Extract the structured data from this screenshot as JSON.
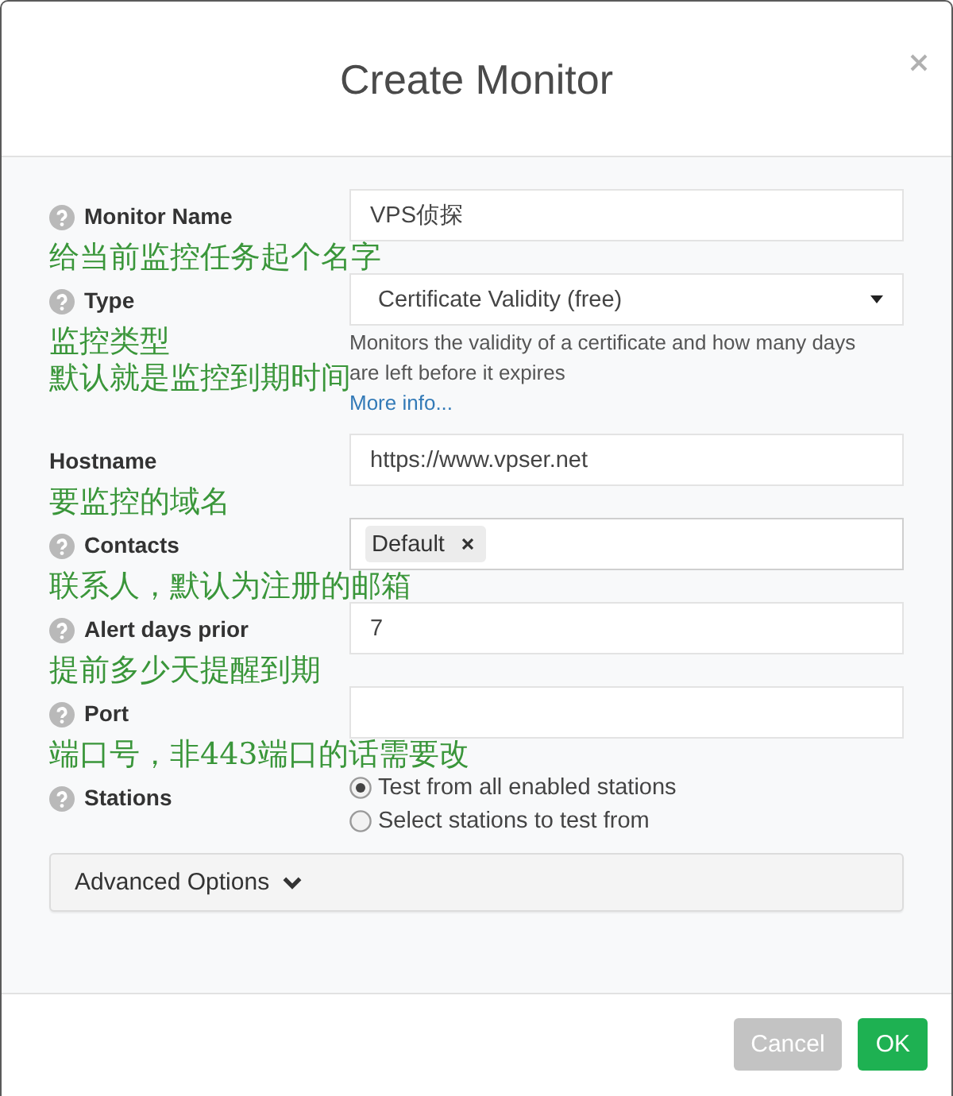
{
  "dialog": {
    "title": "Create Monitor"
  },
  "fields": [
    {
      "kind": "text",
      "label": "Monitor Name",
      "help": true,
      "value": "VPS侦探",
      "annotations": [
        "给当前监控任务起个名字"
      ]
    },
    {
      "kind": "select",
      "label": "Type",
      "help": true,
      "value": "Certificate Validity (free)",
      "description": "Monitors the validity of a certificate and how many days are left before it expires",
      "link": "More info...",
      "annotations": [
        "监控类型",
        "默认就是监控到期时间"
      ]
    },
    {
      "kind": "text",
      "label": "Hostname",
      "help": false,
      "value": "https://www.vpser.net",
      "annotations": [
        "要监控的域名"
      ]
    },
    {
      "kind": "tags",
      "label": "Contacts",
      "help": true,
      "tags": [
        "Default"
      ],
      "annotations": [
        "联系人，默认为注册的邮箱"
      ]
    },
    {
      "kind": "text",
      "label": "Alert days prior",
      "help": true,
      "value": "7",
      "annotations": [
        "提前多少天提醒到期"
      ]
    },
    {
      "kind": "text",
      "label": "Port",
      "help": true,
      "annotations": [
        "端口号，非443端口的话需要改"
      ]
    },
    {
      "kind": "radio",
      "label": "Stations",
      "help": true,
      "options": [
        {
          "label": "Test from all enabled stations",
          "selected": true
        },
        {
          "label": "Select stations to test from",
          "selected": false
        }
      ]
    }
  ],
  "advanced_options": {
    "label": "Advanced Options",
    "expanded": false
  },
  "buttons": [
    {
      "label": "Cancel",
      "kind": "secondary"
    },
    {
      "label": "OK",
      "kind": "primary"
    }
  ]
}
